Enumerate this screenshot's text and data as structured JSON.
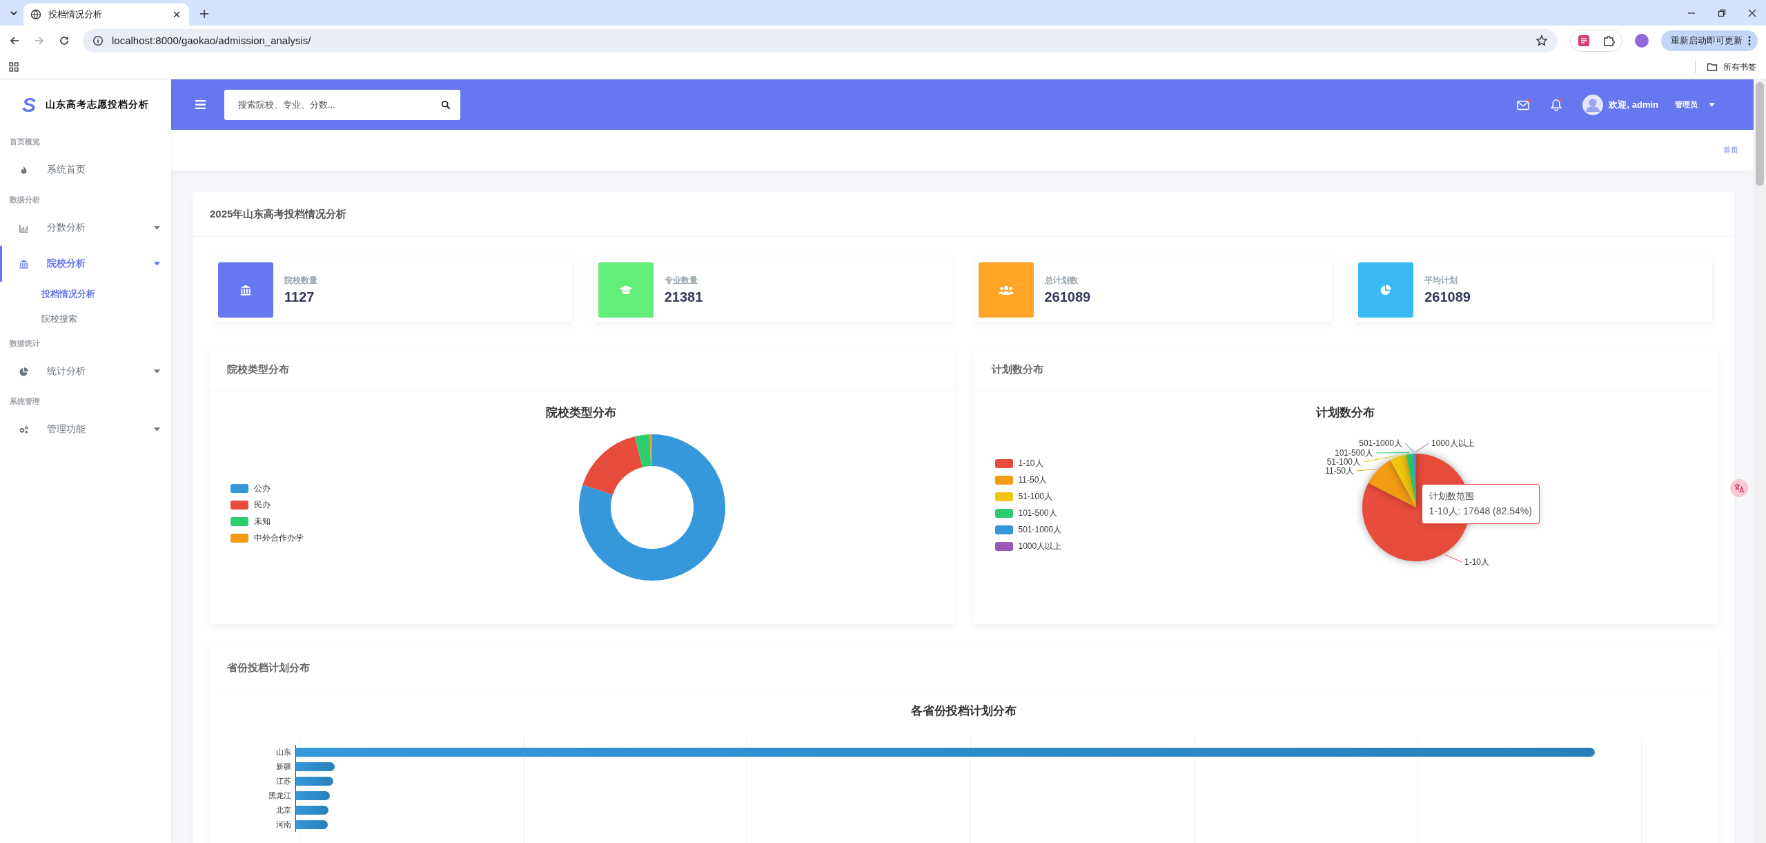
{
  "browser": {
    "tab_title": "投档情况分析",
    "url": "localhost:8000/gaokao/admission_analysis/",
    "update_button": "重新启动即可更新",
    "bookmarks_folder": "所有书签"
  },
  "sidebar": {
    "logo": "S",
    "brand": "山东高考志愿投档分析",
    "sections": [
      {
        "title": "首页概览",
        "items": [
          {
            "kind": "link",
            "label": "系统首页",
            "selected": false
          }
        ]
      },
      {
        "title": "数据分析",
        "items": [
          {
            "kind": "group",
            "label": "分数分析",
            "selected": false
          },
          {
            "kind": "group",
            "label": "院校分析",
            "selected": true,
            "children": [
              {
                "label": "投档情况分析",
                "selected": true
              },
              {
                "label": "院校搜索",
                "selected": false
              }
            ]
          }
        ]
      },
      {
        "title": "数据统计",
        "items": [
          {
            "kind": "group",
            "label": "统计分析",
            "selected": false
          }
        ]
      },
      {
        "title": "系统管理",
        "items": [
          {
            "kind": "group",
            "label": "管理功能",
            "selected": false
          }
        ]
      }
    ]
  },
  "header": {
    "search": {
      "placeholder": "搜索院校、专业、分数..."
    },
    "user_greeting": "欢迎, admin",
    "role": "管理员"
  },
  "breadcrumb": {
    "label": "首页"
  },
  "page": {
    "title": "2025年山东高考投档情况分析",
    "stats": [
      {
        "label": "院校数量",
        "value": "1127",
        "color": "#6777ef"
      },
      {
        "label": "专业数量",
        "value": "21381",
        "color": "#63ed7a"
      },
      {
        "label": "总计划数",
        "value": "261089",
        "color": "#ffa426"
      },
      {
        "label": "平均计划",
        "value": "261089",
        "color": "#3abaf4"
      }
    ],
    "school_type_card": {
      "header": "院校类型分布",
      "chart_title": "院校类型分布",
      "legend": [
        {
          "label": "公办",
          "color": "#3498db"
        },
        {
          "label": "民办",
          "color": "#e74c3c"
        },
        {
          "label": "未知",
          "color": "#2ecc71"
        },
        {
          "label": "中外合作办学",
          "color": "#f39c12"
        }
      ]
    },
    "plan_card": {
      "header": "计划数分布",
      "chart_title": "计划数分布",
      "legend": [
        {
          "label": "1-10人",
          "color": "#e74c3c"
        },
        {
          "label": "11-50人",
          "color": "#f39c12"
        },
        {
          "label": "51-100人",
          "color": "#f1c40f"
        },
        {
          "label": "101-500人",
          "color": "#2ecc71"
        },
        {
          "label": "501-1000人",
          "color": "#3498db"
        },
        {
          "label": "1000人以上",
          "color": "#9b59b6"
        }
      ],
      "callouts": [
        "501-1000人",
        "1000人以上",
        "101-500人",
        "51-100人",
        "11-50人",
        "1-10人"
      ],
      "tooltip": {
        "title": "计划数范围",
        "text": "1-10人: 17648 (82.54%)"
      }
    },
    "province_card": {
      "header": "省份投档计划分布",
      "chart_title": "各省份投档计划分布",
      "bars": [
        {
          "label": "山东",
          "level": 0.968
        },
        {
          "label": "新疆",
          "level": 0.029
        },
        {
          "label": "江苏",
          "level": 0.028
        },
        {
          "label": "黑龙江",
          "level": 0.025
        },
        {
          "label": "北京",
          "level": 0.024
        },
        {
          "label": "河南",
          "level": 0.0235
        }
      ]
    }
  }
}
